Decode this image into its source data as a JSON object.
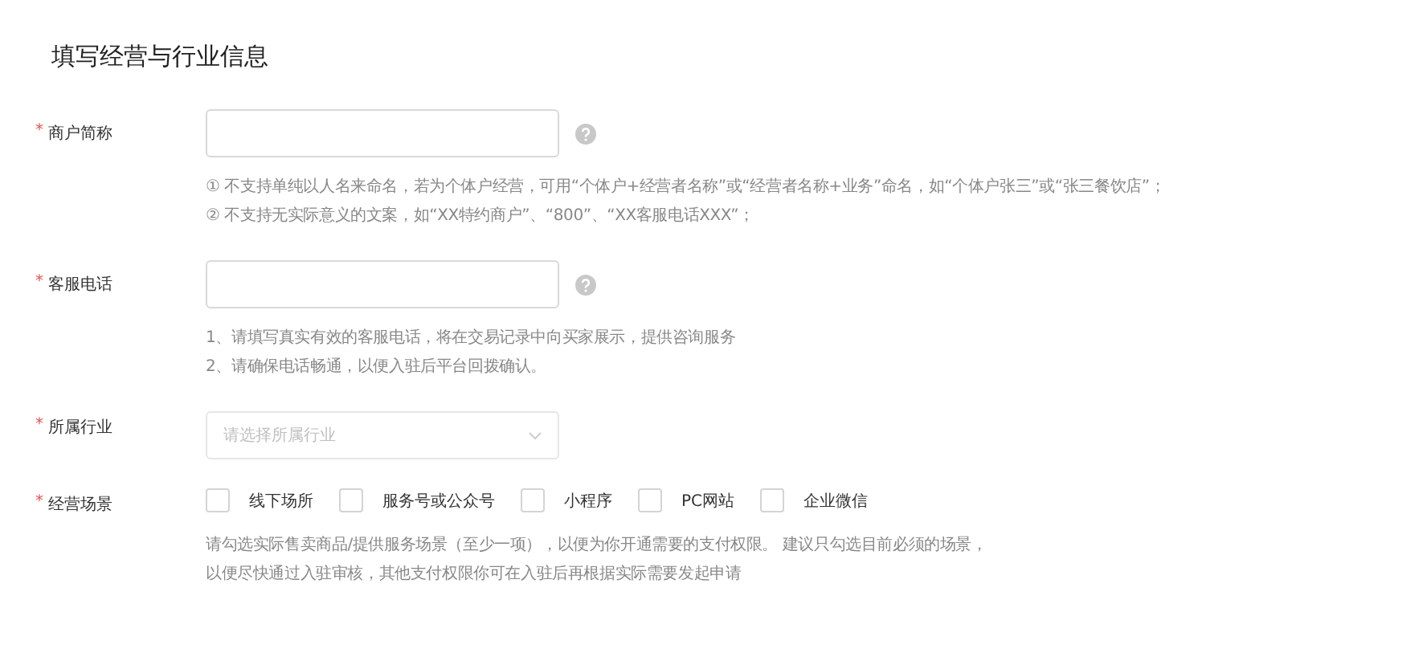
{
  "title": "填写经营与行业信息",
  "fields": [
    {
      "kind": "input",
      "label": "商户简称",
      "required_mark": "*",
      "help": true,
      "hints": [
        "① 不支持单纯以人名来命名，若为个体户经营，可用“个体户+经营者名称”或“经营者名称+业务”命名，如“个体户张三”或“张三餐饮店”；",
        "② 不支持无实际意义的文案，如“XX特约商户”、“800”、“XX客服电话XXX”；"
      ]
    },
    {
      "kind": "input",
      "label": "客服电话",
      "required_mark": "*",
      "help": true,
      "hints": [
        "1、请填写真实有效的客服电话，将在交易记录中向买家展示，提供咨询服务",
        "2、请确保电话畅通，以便入驻后平台回拨确认。"
      ]
    },
    {
      "kind": "select",
      "label": "所属行业",
      "required_mark": "*",
      "placeholder": "请选择所属行业"
    },
    {
      "kind": "checkboxes",
      "label": "经营场景",
      "required_mark": "*",
      "options": [
        {
          "label": "线下场所",
          "checked": false
        },
        {
          "label": "服务号或公众号",
          "checked": false
        },
        {
          "label": "小程序",
          "checked": false
        },
        {
          "label": "PC网站",
          "checked": false
        },
        {
          "label": "企业微信",
          "checked": false
        }
      ],
      "hints": [
        "请勾选实际售卖商品/提供服务场景（至少一项），以便为你开通需要的支付权限。 建议只勾选目前必须的场景，",
        "以便尽快通过入驻审核，其他支付权限你可在入驻后再根据实际需要发起申请"
      ]
    }
  ]
}
